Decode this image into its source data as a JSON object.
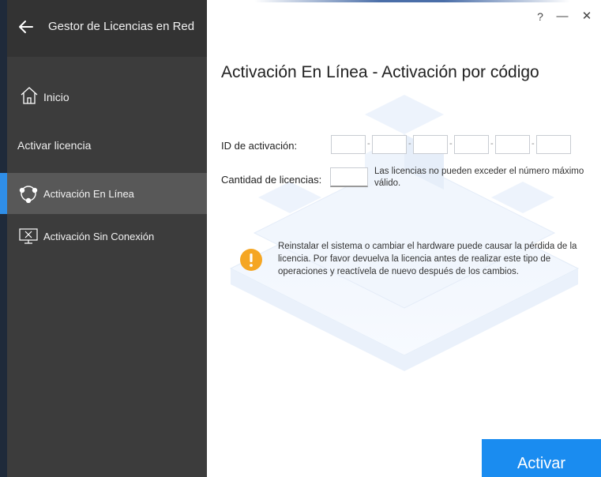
{
  "app": {
    "title": "Gestor de Licencias en Red"
  },
  "sidebar": {
    "home_label": "Inicio",
    "section_label": "Activar licencia",
    "items": [
      {
        "label": "Activación En Línea",
        "icon": "online-activation-icon",
        "active": true
      },
      {
        "label": "Activación Sin Conexión",
        "icon": "offline-activation-icon",
        "active": false
      }
    ]
  },
  "window_controls": {
    "help": "?",
    "minimize": "—",
    "close": "✕"
  },
  "main": {
    "title": "Activación En Línea - Activación por código",
    "activation_id_label": "ID de activación:",
    "activation_id_segments": [
      "",
      "",
      "",
      "",
      "",
      ""
    ],
    "separator": "-",
    "license_qty_label": "Cantidad de licencias:",
    "license_qty_value": "",
    "license_qty_note": "Las licencias no pueden exceder el número máximo válido.",
    "warning_text": "Reinstalar el sistema o cambiar el hardware puede causar la pérdida de la licencia. Por favor devuelva la licencia antes de realizar este tipo de operaciones y reactívela de nuevo después de los cambios.",
    "activate_button": "Activar"
  },
  "colors": {
    "accent": "#1a8cf0",
    "sidebar_bg": "#3c3c3c",
    "sidebar_active": "#585858",
    "warning": "#f5a623"
  }
}
